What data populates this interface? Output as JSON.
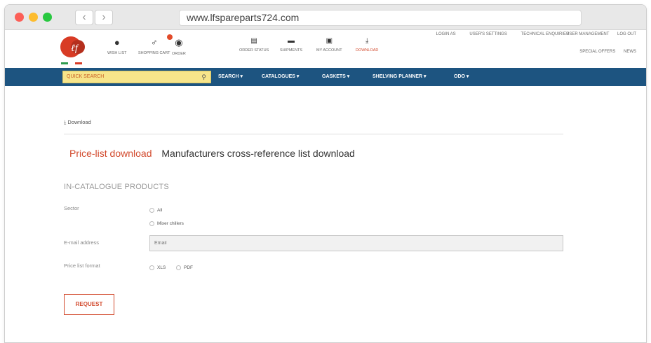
{
  "browser": {
    "url": "www.lfspareparts724.com"
  },
  "header": {
    "top_links": [
      "LOGIN AS",
      "USER'S SETTINGS",
      "TECHNICAL ENQUIRIES",
      "USER MANAGEMENT",
      "LOG OUT"
    ],
    "icons": [
      {
        "label": "WISH LIST"
      },
      {
        "label": "SHOPPING CART"
      },
      {
        "label": "ORDER"
      },
      {
        "label": "ORDER STATUS"
      },
      {
        "label": "SHIPMENTS"
      },
      {
        "label": "MY ACCOUNT"
      },
      {
        "label": "DOWNLOAD"
      }
    ],
    "right_links": [
      "SPECIAL OFFERS",
      "NEWS"
    ]
  },
  "nav": {
    "quick_search": "QUICK SEARCH",
    "items": [
      "SEARCH ▾",
      "CATALOGUES ▾",
      "GASKETS ▾",
      "SHELVING PLANNER ▾",
      "ODO ▾"
    ]
  },
  "page": {
    "breadcrumb": "Download",
    "tab_active": "Price-list download",
    "tab_other": "Manufacturers cross-reference list download",
    "section_title": "IN-CATALOGUE PRODUCTS",
    "sector_label": "Sector",
    "sector_options": [
      "All",
      "Mixer chillers"
    ],
    "email_label": "E-mail address",
    "email_placeholder": "Email",
    "format_label": "Price list format",
    "format_options": [
      "XLS",
      "PDF"
    ],
    "request_button": "REQUEST"
  },
  "colors": {
    "accent": "#d24a2d",
    "nav_bg": "#1d5480",
    "search_bg": "#f7e58a"
  }
}
